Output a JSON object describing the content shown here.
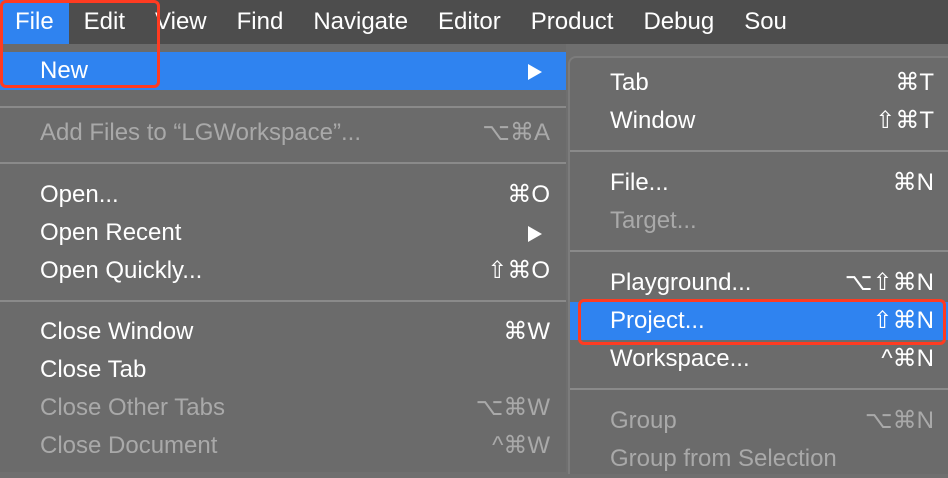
{
  "menubar": {
    "items": [
      "File",
      "Edit",
      "View",
      "Find",
      "Navigate",
      "Editor",
      "Product",
      "Debug",
      "Sou"
    ]
  },
  "file_menu": {
    "items": [
      {
        "label": "New",
        "shortcut": "",
        "submenu": true,
        "highlighted": true
      },
      {
        "label": "Add Files to “LGWorkspace”...",
        "shortcut": "⌥⌘A",
        "disabled": true
      },
      {
        "label": "Open...",
        "shortcut": "⌘O"
      },
      {
        "label": "Open Recent",
        "shortcut": "",
        "submenu": true
      },
      {
        "label": "Open Quickly...",
        "shortcut": "⇧⌘O"
      },
      {
        "label": "Close Window",
        "shortcut": "⌘W"
      },
      {
        "label": "Close Tab",
        "shortcut": ""
      },
      {
        "label": "Close Other Tabs",
        "shortcut": "⌥⌘W",
        "disabled": true
      },
      {
        "label": "Close Document",
        "shortcut": "^⌘W",
        "disabled": true
      }
    ]
  },
  "new_submenu": {
    "items": [
      {
        "label": "Tab",
        "shortcut": "⌘T"
      },
      {
        "label": "Window",
        "shortcut": "⇧⌘T"
      },
      {
        "label": "File...",
        "shortcut": "⌘N"
      },
      {
        "label": "Target...",
        "shortcut": "",
        "disabled": true
      },
      {
        "label": "Playground...",
        "shortcut": "⌥⇧⌘N"
      },
      {
        "label": "Project...",
        "shortcut": "⇧⌘N",
        "highlighted": true
      },
      {
        "label": "Workspace...",
        "shortcut": "^⌘N"
      },
      {
        "label": "Group",
        "shortcut": "⌥⌘N",
        "disabled": true
      },
      {
        "label": "Group from Selection",
        "shortcut": "",
        "disabled": true
      }
    ]
  },
  "colors": {
    "highlight": "#2f83f0",
    "annotation": "#ff3b21",
    "menu_bg": "#6b6b6b",
    "menubar_bg": "#4d4d4d"
  },
  "icons": {
    "submenu_arrow": "triangle-right-icon"
  }
}
